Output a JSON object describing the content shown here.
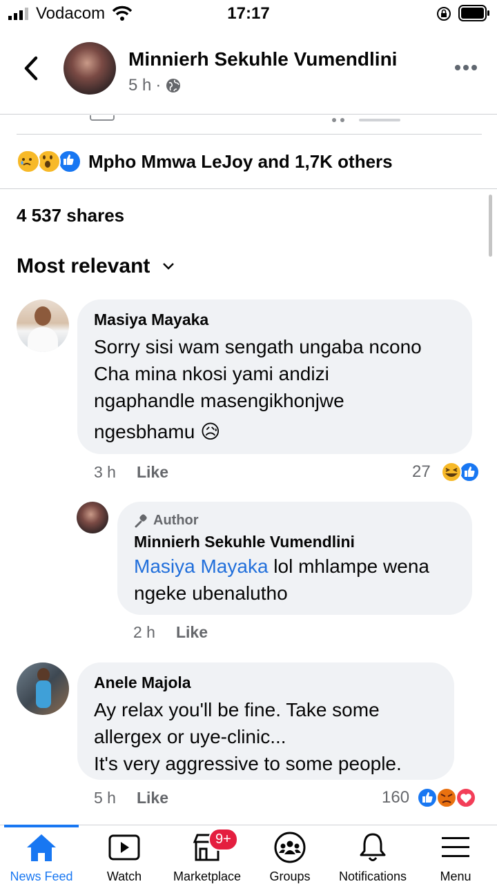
{
  "status_bar": {
    "carrier": "Vodacom",
    "time": "17:17"
  },
  "post": {
    "author": "Minnierh Sekuhle Vumendlini",
    "time": "5 h",
    "reactions_text": "Mpho Mmwa LeJoy and 1,7K others",
    "shares": "4 537 shares"
  },
  "sort_label": "Most relevant",
  "comments": [
    {
      "name": "Masiya Mayaka",
      "lines": [
        "Sorry sisi wam sengath ungaba ncono",
        "Cha mina nkosi yami andizi",
        "ngaphandle masengikhonjwe",
        "ngesbhamu 😥"
      ],
      "time": "3 h",
      "like": "Like",
      "count": "27"
    },
    {
      "tag": "Author",
      "name": "Minnierh Sekuhle Vumendlini",
      "mention": "Masiya Mayaka",
      "line1_rest": " lol mhlampe wena",
      "line2": "ngeke ubenalutho",
      "time": "2 h",
      "like": "Like"
    },
    {
      "name": "Anele Majola",
      "lines": [
        "Ay relax you'll be fine. Take some",
        "allergex or uye-clinic...",
        "It's very aggressive to some people."
      ],
      "time": "5 h",
      "like": "Like",
      "count": "160"
    }
  ],
  "nav": {
    "items": [
      {
        "label": "News Feed",
        "icon": "home-icon"
      },
      {
        "label": "Watch",
        "icon": "watch-icon"
      },
      {
        "label": "Marketplace",
        "icon": "marketplace-icon"
      },
      {
        "label": "Groups",
        "icon": "groups-icon"
      },
      {
        "label": "Notifications",
        "icon": "bell-icon"
      },
      {
        "label": "Menu",
        "icon": "menu-icon"
      }
    ],
    "marketplace_badge": "9+"
  },
  "colors": {
    "accent": "#1877f2",
    "badge": "#e41e3f",
    "bubble": "#f0f2f5",
    "muted": "#65676b"
  }
}
